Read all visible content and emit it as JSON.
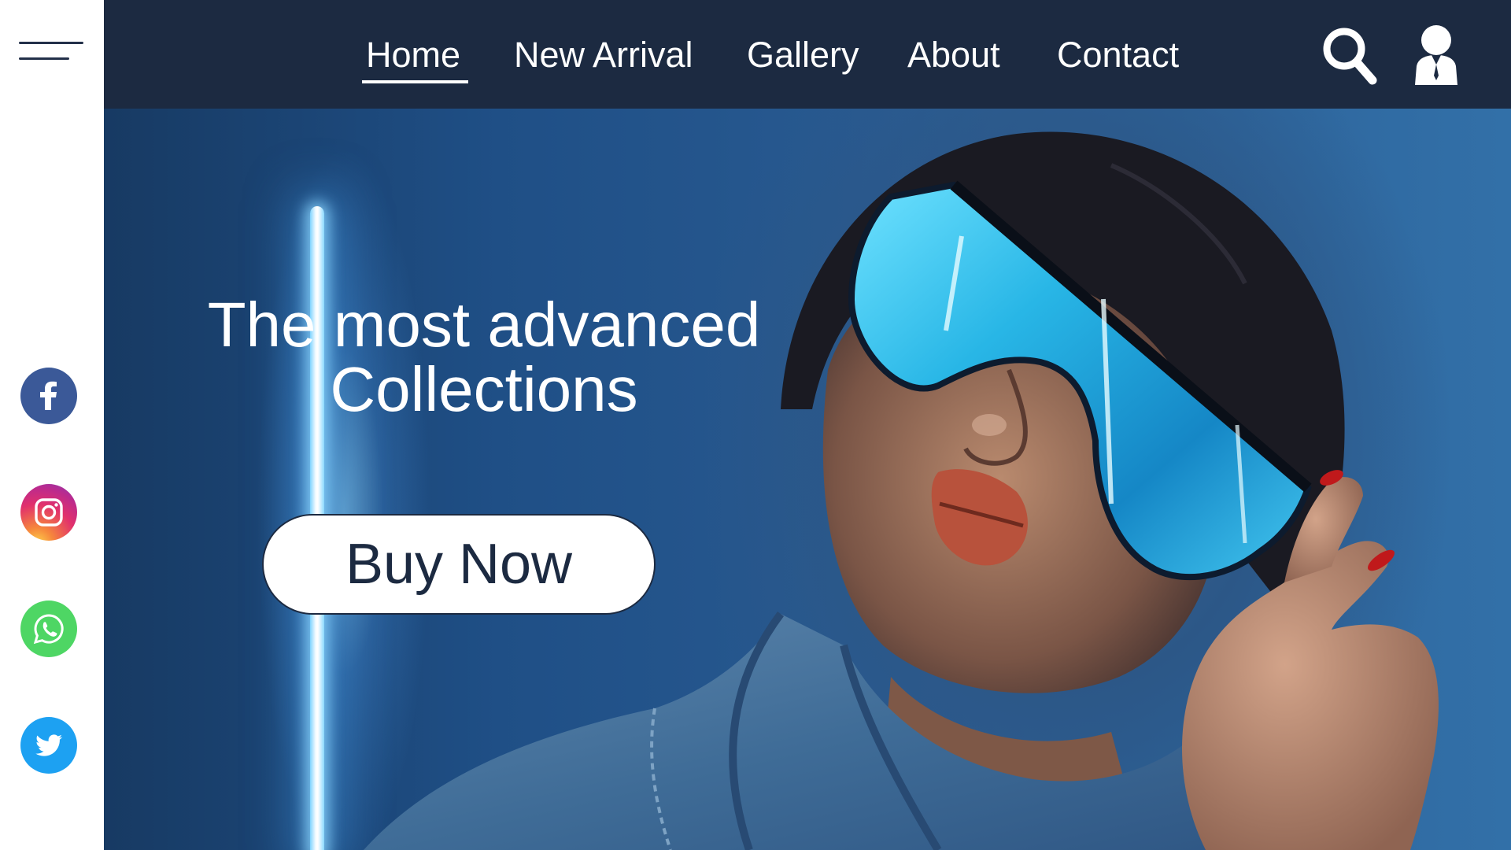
{
  "nav": {
    "items": [
      {
        "label": "Home",
        "active": true
      },
      {
        "label": "New Arrival"
      },
      {
        "label": "Gallery"
      },
      {
        "label": "About"
      },
      {
        "label": "Contact"
      }
    ],
    "icons": {
      "menu": "menu-icon",
      "search": "search-icon",
      "user": "user-icon"
    }
  },
  "social": [
    "facebook-icon",
    "instagram-icon",
    "whatsapp-icon",
    "twitter-icon"
  ],
  "hero": {
    "headline_line1": "The most advanced",
    "headline_line2": "Collections",
    "cta_label": "Buy Now"
  },
  "colors": {
    "nav_bg": "#1c2a41",
    "accent_text": "#ffffff",
    "facebook": "#3b5998",
    "whatsapp": "#4ed664",
    "twitter": "#1da1f2",
    "lens": "#29b6e8"
  }
}
